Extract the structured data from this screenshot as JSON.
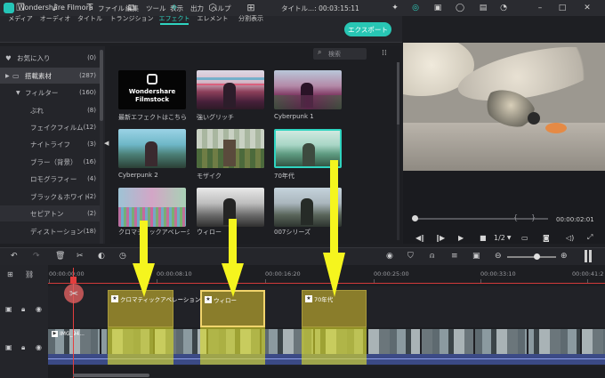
{
  "app": {
    "name": "Wondershare Filmora",
    "menu": [
      "ファイル",
      "編集",
      "ツール",
      "表示",
      "出力",
      "ヘルプ"
    ],
    "doc_title": "タイトル...",
    "doc_time": ": 00:03:15:11"
  },
  "tabs": [
    {
      "label": "メディア",
      "icon": "folder-icon"
    },
    {
      "label": "オーディオ",
      "icon": "music-icon"
    },
    {
      "label": "タイトル",
      "icon": "text-icon"
    },
    {
      "label": "トランジション",
      "icon": "transition-icon"
    },
    {
      "label": "エフェクト",
      "icon": "effects-icon",
      "active": true
    },
    {
      "label": "エレメント",
      "icon": "elements-icon"
    },
    {
      "label": "分割表示",
      "icon": "split-icon"
    }
  ],
  "export_label": "エクスポート",
  "sidebar": {
    "items": [
      {
        "label": "お気に入り",
        "count": "(0)",
        "icon": "♥"
      },
      {
        "label": "搭載素材",
        "count": "(287)",
        "icon": "▶"
      },
      {
        "label": "フィルター",
        "count": "(160)",
        "icon": "▼"
      },
      {
        "label": "ぶれ",
        "count": "(8)"
      },
      {
        "label": "フェイクフィルム",
        "count": "(12)"
      },
      {
        "label": "ナイトライフ",
        "count": "(3)"
      },
      {
        "label": "ブラー（背景）",
        "count": "(16)"
      },
      {
        "label": "ロモグラフィー",
        "count": "(4)"
      },
      {
        "label": "ブラック＆ホワイト",
        "count": "(2)"
      },
      {
        "label": "セピアトン",
        "count": "(2)"
      },
      {
        "label": "ディストーション",
        "count": "(18)"
      }
    ]
  },
  "search": {
    "placeholder": "検索"
  },
  "effects": [
    {
      "label": "最新エフェクトはこちら",
      "brand1": "Wondershare",
      "brand2": "Filmstock"
    },
    {
      "label": "強いグリッチ"
    },
    {
      "label": "Cyberpunk 1"
    },
    {
      "label": "Cyberpunk 2"
    },
    {
      "label": "モザイク"
    },
    {
      "label": "70年代"
    },
    {
      "label": "クロマティックアベレーション"
    },
    {
      "label": "ウィロー"
    },
    {
      "label": "007シリーズ"
    }
  ],
  "preview": {
    "time": "00:00:02:01",
    "speed": "1/2"
  },
  "timeline": {
    "ticks": [
      "00:00:00:00",
      "00:00:08:10",
      "00:00:16:20",
      "00:00:25:00",
      "00:00:33:10",
      "00:00:41:2"
    ],
    "fx_clips": [
      "クロマティックアベレーション",
      "ウィロー",
      "70年代"
    ],
    "video_clip": "IMG_94..."
  },
  "colors": {
    "accent": "#2fd4c0",
    "fx_clip": "#8a7d2b",
    "arrow": "#f5f51e",
    "playhead": "#e33e3e"
  }
}
